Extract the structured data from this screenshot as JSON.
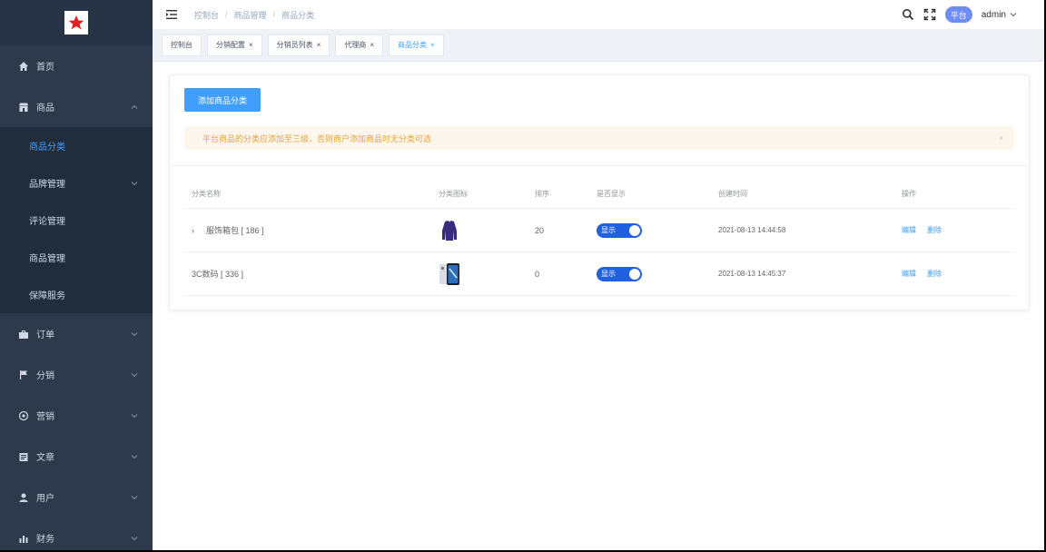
{
  "sidebar": {
    "items": [
      {
        "label": "首页",
        "icon": "home-icon"
      },
      {
        "label": "商品",
        "icon": "shop-icon",
        "expanded": true
      },
      {
        "label": "订单",
        "icon": "order-icon"
      },
      {
        "label": "分销",
        "icon": "flag-icon"
      },
      {
        "label": "营销",
        "icon": "marketing-icon"
      },
      {
        "label": "文章",
        "icon": "article-icon"
      },
      {
        "label": "用户",
        "icon": "user-icon"
      },
      {
        "label": "财务",
        "icon": "finance-icon"
      }
    ],
    "submenu": [
      {
        "label": "商品分类",
        "active": true
      },
      {
        "label": "品牌管理",
        "has_children": true
      },
      {
        "label": "评论管理"
      },
      {
        "label": "商品管理"
      },
      {
        "label": "保障服务"
      }
    ]
  },
  "navbar": {
    "breadcrumb": [
      "控制台",
      "商品管理",
      "商品分类"
    ],
    "role": "平台",
    "username": "admin"
  },
  "tags": [
    {
      "label": "控制台",
      "closable": false
    },
    {
      "label": "分销配置",
      "closable": true
    },
    {
      "label": "分销员列表",
      "closable": true
    },
    {
      "label": "代理商",
      "closable": true
    },
    {
      "label": "商品分类",
      "closable": true,
      "active": true
    }
  ],
  "toolbar": {
    "add_label": "添加商品分类"
  },
  "alert": {
    "text": "平台商品的分类应添加至三级，否则商户添加商品时无分类可选",
    "close": "×"
  },
  "table": {
    "headers": [
      "分类名称",
      "分类图标",
      "排序",
      "是否显示",
      "创建时间",
      "操作"
    ],
    "rows": [
      {
        "name": "服饰箱包 [ 186 ]",
        "expandable": true,
        "sort": "20",
        "show": "显示",
        "created": "2021-08-13 14:44:58",
        "edit": "编辑",
        "delete": "删除",
        "thumb": "sweater"
      },
      {
        "name": "3C数码 [ 336 ]",
        "expandable": false,
        "sort": "0",
        "show": "显示",
        "created": "2021-08-13 14:45:37",
        "edit": "编辑",
        "delete": "删除",
        "thumb": "phone"
      }
    ]
  },
  "colors": {
    "sidebar_bg": "#2d3a4b",
    "primary": "#409eff",
    "switch_on": "#1f5fe0",
    "alert_bg": "#fdf6ec",
    "alert_text": "#e6a23c"
  }
}
